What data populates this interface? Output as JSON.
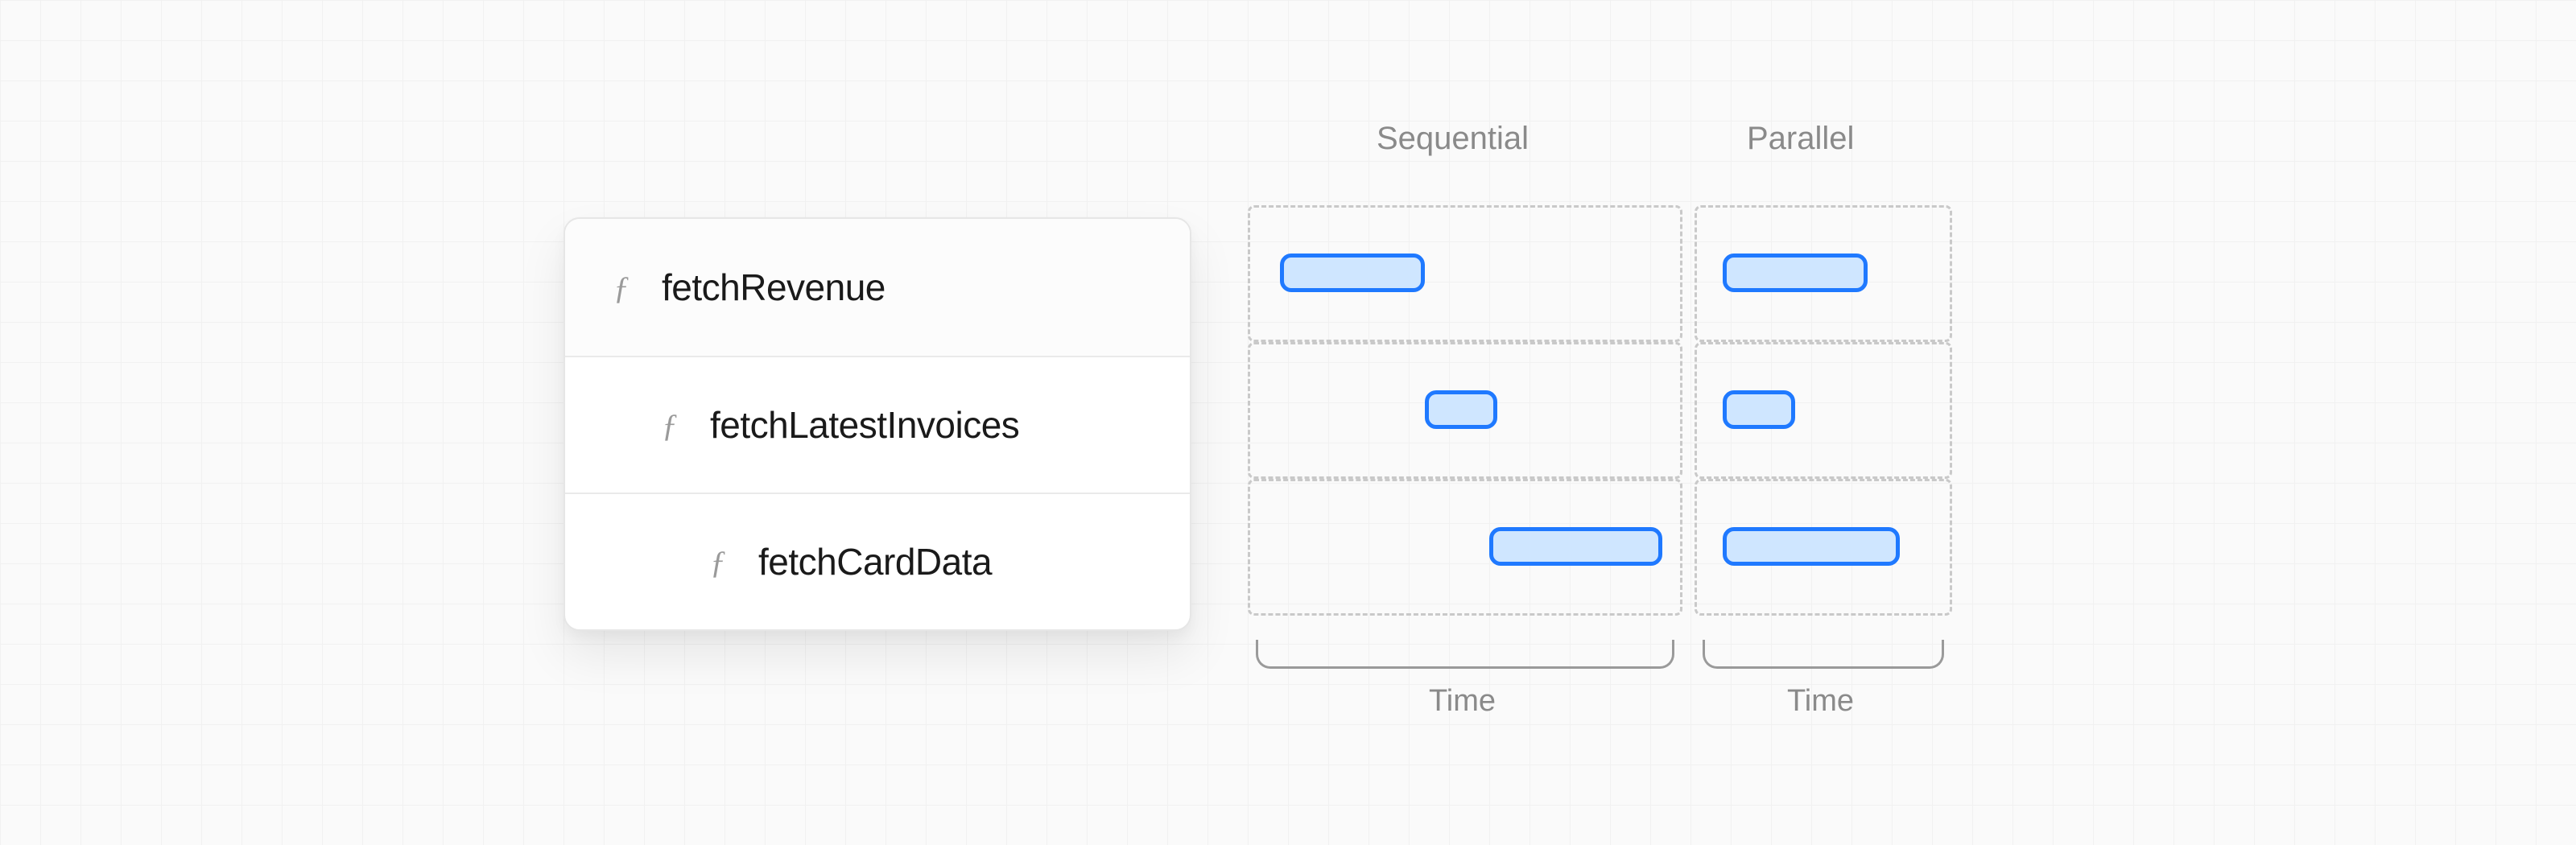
{
  "functions": [
    {
      "name": "fetchRevenue",
      "indent": 0
    },
    {
      "name": "fetchLatestInvoices",
      "indent": 1
    },
    {
      "name": "fetchCardData",
      "indent": 2
    }
  ],
  "headers": {
    "sequential": "Sequential",
    "parallel": "Parallel"
  },
  "time_label": "Time",
  "chart_data": {
    "type": "bar",
    "note": "Horizontal timeline bars showing start offset and duration (arbitrary time units). Sequential bars cascade; parallel bars all start at 0.",
    "rows": [
      "fetchRevenue",
      "fetchLatestInvoices",
      "fetchCardData"
    ],
    "sequential": [
      {
        "start": 0,
        "duration": 3
      },
      {
        "start": 3,
        "duration": 1.4
      },
      {
        "start": 4.4,
        "duration": 3.6
      }
    ],
    "parallel": [
      {
        "start": 0,
        "duration": 3
      },
      {
        "start": 0,
        "duration": 1.4
      },
      {
        "start": 0,
        "duration": 3.6
      }
    ],
    "sequential_total_time": 8,
    "parallel_total_time": 3.6,
    "colors": {
      "bar_fill": "#cfe6ff",
      "bar_stroke": "#1f79ff"
    }
  }
}
